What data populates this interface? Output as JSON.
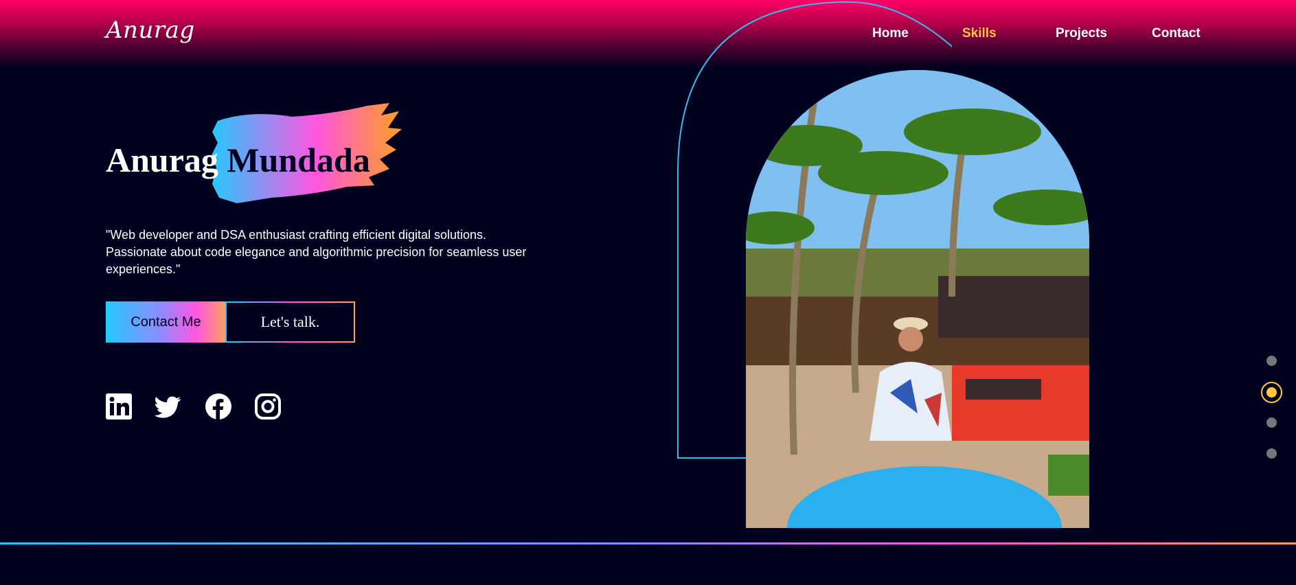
{
  "brand": {
    "logo_text": "Anurag"
  },
  "nav": {
    "items": [
      {
        "label": "Home",
        "active": false
      },
      {
        "label": "Skills",
        "active": true
      },
      {
        "label": "Projects",
        "active": false
      },
      {
        "label": "Contact",
        "active": false
      }
    ]
  },
  "hero": {
    "first_name": "Anurag",
    "last_name": "Mundada",
    "tagline": "\"Web developer and DSA enthusiast crafting efficient digital solutions. Passionate about code elegance and algorithmic precision for seamless user experiences.\"",
    "contact_button": "Contact Me",
    "talk_button": "Let's talk."
  },
  "socials": [
    {
      "icon": "linkedin-icon"
    },
    {
      "icon": "twitter-icon"
    },
    {
      "icon": "facebook-icon"
    },
    {
      "icon": "instagram-icon"
    }
  ],
  "section_dots": {
    "count": 4,
    "active_index": 1
  },
  "colors": {
    "background": "#00001f",
    "accent": "#ffc83d",
    "header_gradient_top": "#ff0066",
    "gradient_cyan": "#25c8ff",
    "gradient_pink": "#ff55e0",
    "gradient_orange": "#ffa060"
  }
}
